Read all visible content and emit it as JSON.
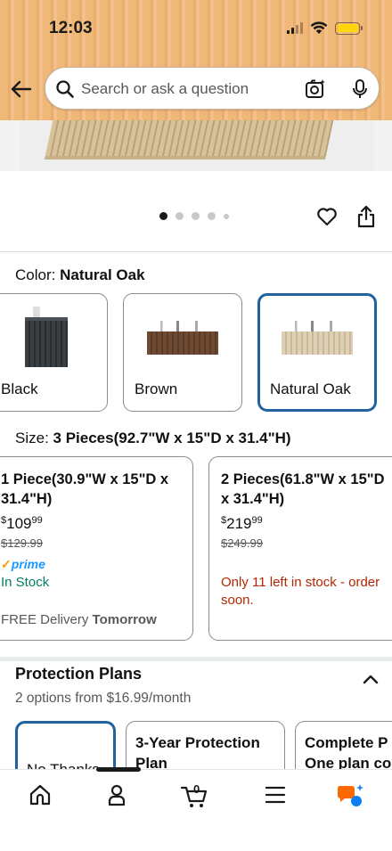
{
  "status_bar": {
    "time": "12:03"
  },
  "search": {
    "placeholder": "Search or ask a question"
  },
  "color": {
    "label": "Color:",
    "selected_value": "Natural Oak",
    "options": [
      {
        "label": "Black"
      },
      {
        "label": "Brown"
      },
      {
        "label": "Natural Oak"
      }
    ]
  },
  "size": {
    "label": "Size:",
    "selected_value": "3 Pieces(92.7\"W x 15\"D x 31.4\"H)",
    "options": [
      {
        "title_line1": "1 Piece(30.9\"W x 15\"D x",
        "title_line2": "31.4\"H)",
        "price_symbol": "$",
        "price_whole": "109",
        "price_fraction": "99",
        "list_price": "$129.99",
        "prime": "prime",
        "availability": "In Stock",
        "delivery_prefix": "FREE Delivery",
        "delivery_day": "Tomorrow"
      },
      {
        "title_line1": "2 Pieces(61.8\"W x 15\"D",
        "title_line2": "x 31.4\"H)",
        "price_symbol": "$",
        "price_whole": "219",
        "price_fraction": "99",
        "list_price": "$249.99",
        "availability_line1": "Only 11 left in stock - order",
        "availability_line2": "soon."
      }
    ]
  },
  "protection_plans": {
    "title": "Protection Plans",
    "subtitle": "2 options from $16.99/month",
    "options": [
      {
        "line1": "No Thanks",
        "line2": ""
      },
      {
        "line1": "3-Year Protection",
        "line2": "Plan"
      },
      {
        "line1": "Complete P",
        "line2": "One plan co"
      }
    ]
  },
  "image_carousel": {
    "count": 5,
    "active_index": 0
  },
  "colors": {
    "header_orange": "#f0b878",
    "selected_border": "#2162a1",
    "in_stock_green": "#067d62",
    "low_stock_red": "#b12704",
    "prime_blue": "#1a98ff",
    "rufus_orange": "#ff6a00",
    "rufus_blue": "#0d7ff2"
  },
  "bottom_nav": {
    "icons": [
      "home-icon",
      "account-icon",
      "cart-icon",
      "menu-icon",
      "rufus-icon"
    ],
    "cart_count": "0"
  }
}
